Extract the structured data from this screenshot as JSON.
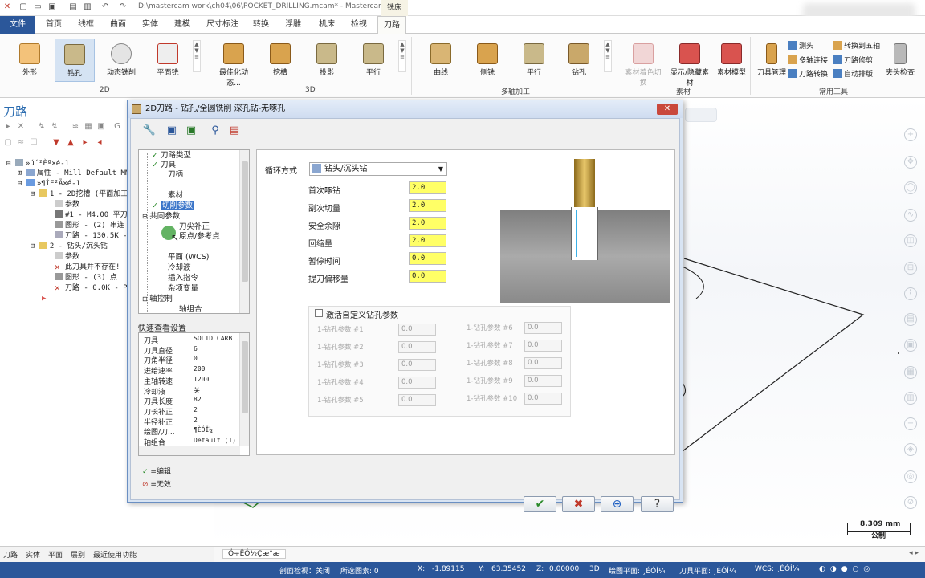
{
  "window": {
    "title": "D:\\mastercam work\\ch04\\06\\POCKET_DRILLING.mcam* - Mastercam...",
    "context_tab": "铣床"
  },
  "menu": {
    "tabs": [
      "文件",
      "首页",
      "线框",
      "曲面",
      "实体",
      "建模",
      "尺寸标注",
      "转换",
      "浮雕",
      "机床",
      "检视",
      "刀路"
    ]
  },
  "ribbon": {
    "group_2d": {
      "label": "2D",
      "buttons": [
        "外形",
        "钻孔",
        "动态铣削",
        "平面铣"
      ]
    },
    "group_3d": {
      "label": "3D",
      "buttons": [
        "最佳化动态...",
        "挖槽",
        "投影",
        "平行"
      ]
    },
    "group_multi": {
      "label": "多轴加工",
      "buttons": [
        "曲线",
        "侧铣",
        "平行",
        "钻孔"
      ]
    },
    "group_stock": {
      "label": "素材",
      "buttons": [
        "素材着色切换",
        "显示/隐藏素材",
        "素材模型"
      ]
    },
    "group_tools": {
      "label": "常用工具",
      "buttons": [
        "刀具管理",
        "测头",
        "多轴连接",
        "刀路转换",
        "转换到五轴",
        "刀路修剪",
        "自动排版",
        "夹头检查"
      ]
    }
  },
  "left_panel": {
    "title": "刀路",
    "tree": [
      "»ú´²Èº×é-1",
      "属性 - Mill Default MM",
      "»¶ÍE²Ã×é-1",
      "1 - 2D挖槽 (平面加工",
      "参数",
      "#1 - M4.00 平刀",
      "图形 - (2) 串连",
      "刀路 - 130.5K -",
      "2 - 钻头/沉头钻",
      "参数",
      "此刀具并不存在!",
      "图形 - (3) 点",
      "刀路 - 0.0K - PO"
    ]
  },
  "bottom_tabs": [
    "刀路",
    "实体",
    "平面",
    "层别",
    "最近使用功能"
  ],
  "view_tab": "Ö÷ÊÓ½Çæ°æ",
  "dialog": {
    "title": "2D刀路 - 钻孔/全圆铣削 深孔钻-无啄孔",
    "nav": [
      "刀路类型",
      "刀具",
      "刀柄",
      "素材",
      "切削参数",
      "共同参数",
      "刀尖补正",
      "原点/参考点",
      "平面 (WCS)",
      "冷却液",
      "插入指令",
      "杂项变量",
      "轴控制",
      "轴组合"
    ],
    "quick_view_label": "快速查看设置",
    "quick_view": [
      [
        "刀具",
        "SOLID CARB..."
      ],
      [
        "刀具直径",
        "6"
      ],
      [
        "刀角半径",
        "0"
      ],
      [
        "进给速率",
        "200"
      ],
      [
        "主轴转速",
        "1200"
      ],
      [
        "冷却液",
        "关"
      ],
      [
        "刀具长度",
        "82"
      ],
      [
        "刀长补正",
        "2"
      ],
      [
        "半径补正",
        "2"
      ],
      [
        "绘图/刀...",
        "¶ÈÓÏ¼"
      ],
      [
        "轴组合",
        "Default (1)"
      ]
    ],
    "legend": {
      "edited": "=编辑",
      "invalid": "=无效"
    },
    "cycle_label": "循环方式",
    "cycle_value": "钻头/沉头钻",
    "fields": [
      {
        "label": "首次啄钻",
        "value": "2.0"
      },
      {
        "label": "副次切量",
        "value": "2.0"
      },
      {
        "label": "安全余隙",
        "value": "2.0"
      },
      {
        "label": "回缩量",
        "value": "2.0"
      },
      {
        "label": "暂停时间",
        "value": "0.0"
      },
      {
        "label": "提刀偏移量",
        "value": "0.0"
      }
    ],
    "custom_checkbox": "激活自定义钻孔参数",
    "custom_params": [
      {
        "label": "1-钻孔参数 #1",
        "value": "0.0"
      },
      {
        "label": "1-钻孔参数 #2",
        "value": "0.0"
      },
      {
        "label": "1-钻孔参数 #3",
        "value": "0.0"
      },
      {
        "label": "1-钻孔参数 #4",
        "value": "0.0"
      },
      {
        "label": "1-钻孔参数 #5",
        "value": "0.0"
      },
      {
        "label": "1-钻孔参数 #6",
        "value": "0.0"
      },
      {
        "label": "1-钻孔参数 #7",
        "value": "0.0"
      },
      {
        "label": "1-钻孔参数 #8",
        "value": "0.0"
      },
      {
        "label": "1-钻孔参数 #9",
        "value": "0.0"
      },
      {
        "label": "1-钻孔参数 #10",
        "value": "0.0"
      }
    ]
  },
  "scale": {
    "value": "8.309 mm",
    "unit": "公制"
  },
  "status": {
    "section": "剖面检视：关闭",
    "selected": "所选图素: 0",
    "x_label": "X:",
    "x": "-1.89115",
    "y_label": "Y:",
    "y": "63.35452",
    "z_label": "Z:",
    "z": "0.00000",
    "mode": "3D",
    "cplane": "绘图平面: ¸ÉÓÍ¼",
    "tplane": "刀具平面: ¸ÉÓÍ¼",
    "wcs": "WCS: ¸ÉÓÍ¼"
  },
  "colors": {
    "accent": "#2b579a",
    "field_highlight": "#ffff66",
    "selection": "#3b75c9"
  }
}
